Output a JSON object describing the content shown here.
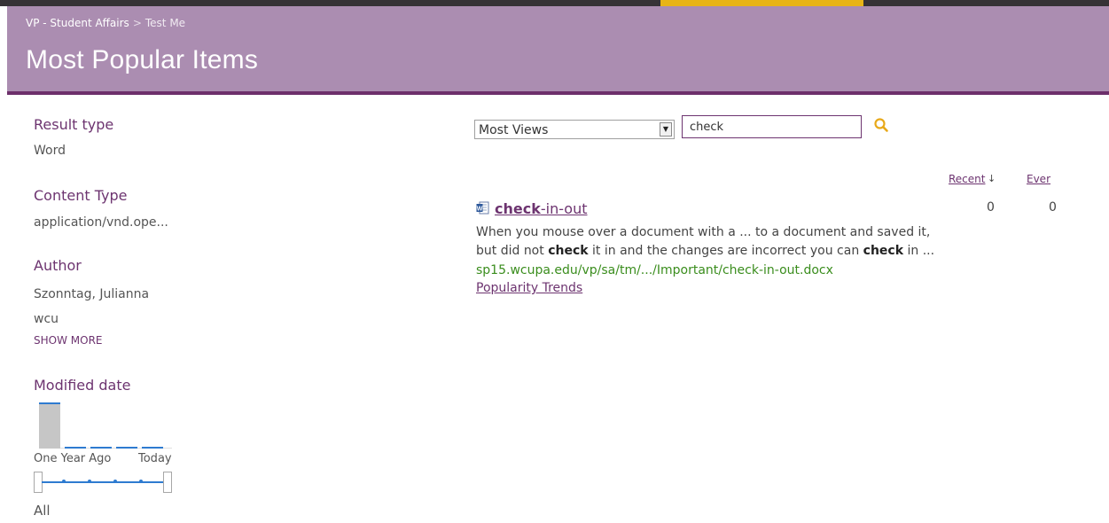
{
  "breadcrumb": {
    "parent": "VP - Student Affairs",
    "separator": ">",
    "current": "Test Me"
  },
  "page_title": "Most Popular Items",
  "refiners": {
    "result_type": {
      "title": "Result type",
      "values": [
        "Word"
      ]
    },
    "content_type": {
      "title": "Content Type",
      "values": [
        "application/vnd.ope..."
      ]
    },
    "author": {
      "title": "Author",
      "values": [
        "Szonntag, Julianna",
        "wcu"
      ],
      "show_more": "SHOW MORE"
    },
    "modified_date": {
      "title": "Modified date",
      "histogram": [
        1,
        0,
        0,
        0,
        0
      ],
      "axis_left": "One Year Ago",
      "axis_right": "Today",
      "slider_label": "All"
    }
  },
  "search": {
    "sort_value": "Most Views",
    "query": "check"
  },
  "columns": {
    "recent": "Recent",
    "recent_sort": "↓",
    "ever": "Ever"
  },
  "result": {
    "title_bold": "check",
    "title_rest": "-in-out",
    "snippet_line1": "When you mouse over a document with a ... to a document and saved it,",
    "snippet_line2_a": "but did not ",
    "snippet_line2_b": "check",
    "snippet_line2_c": " it in and the changes are incorrect you can ",
    "snippet_line2_d": "check",
    "snippet_line2_e": " in ...",
    "url": "sp15.wcupa.edu/vp/sa/tm/.../Important/check-in-out.docx",
    "popularity_link": "Popularity Trends",
    "recent_count": "0",
    "ever_count": "0"
  },
  "colors": {
    "header_bg": "#ab8db1",
    "header_border": "#6d2f6b",
    "accent": "#6d3470",
    "url_green": "#3a8d1d",
    "top_accent": "#e8b416",
    "chart_blue": "#2e7bd0"
  }
}
